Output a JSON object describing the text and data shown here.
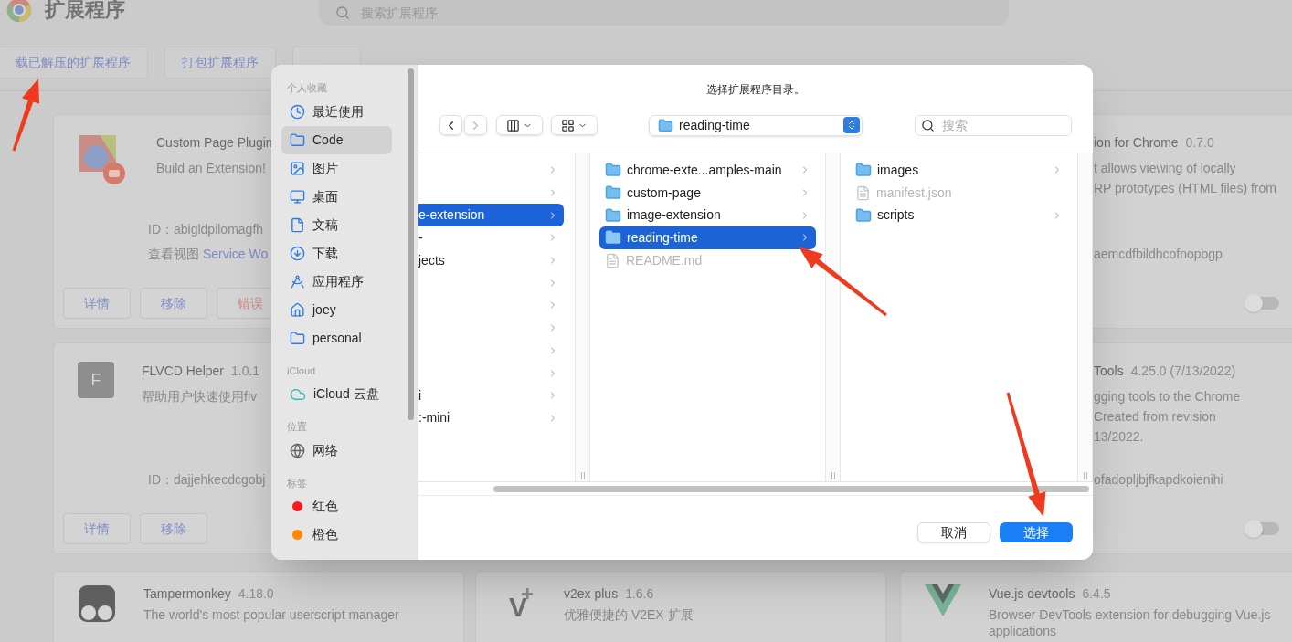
{
  "page": {
    "title": "扩展程序",
    "search": {
      "placeholder": "搜索扩展程序"
    },
    "actions": [
      "载已解压的扩展程序",
      "打包扩展程序"
    ]
  },
  "extensions": [
    {
      "kind": "custom-page",
      "name": "Custom Page Plugin",
      "description": [
        "Build an Extension!"
      ],
      "id_text": "ID：abigldpilomagfh",
      "views": {
        "label": "查看视图",
        "link": "Service Wo"
      },
      "buttons": [
        {
          "label": "详情",
          "kind": "normal"
        },
        {
          "label": "移除",
          "kind": "normal"
        },
        {
          "label": "错误",
          "kind": "error"
        }
      ]
    },
    {
      "name": "ion for Chrome",
      "version": "0.7.0",
      "description": [
        "t allows viewing of locally",
        "RP prototypes (HTML files) from"
      ],
      "id_text": "aemcdfbildhcofnopogp",
      "toggle": {
        "on": false
      }
    },
    {
      "kind": "letter",
      "icon_text": "F",
      "name": "FLVCD Helper",
      "version": "1.0.1",
      "description": [
        "帮助用户快速使用flv"
      ],
      "id_text": "ID：dajjehkecdcgobj",
      "buttons": [
        {
          "label": "详情",
          "kind": "normal"
        },
        {
          "label": "移除",
          "kind": "normal"
        }
      ]
    },
    {
      "name": "Tools",
      "version": "4.25.0 (7/13/2022)",
      "description": [
        "gging tools to the Chrome",
        "Created from revision",
        "13/2022."
      ],
      "id_text": "ofadopljbjfkapdkoienihi",
      "toggle": {
        "on": false
      }
    },
    {
      "kind": "tampermonkey",
      "name": "Tampermonkey",
      "version": "4.18.0",
      "description": [
        "The world's most popular userscript manager"
      ]
    },
    {
      "kind": "vplus",
      "icon_text": "V",
      "name": "v2ex plus",
      "version": "1.6.6",
      "description": [
        "优雅便捷的 V2EX 扩展"
      ]
    },
    {
      "kind": "vue",
      "name": "Vue.js devtools",
      "version": "6.4.5",
      "description": [
        "Browser DevTools extension for debugging Vue.js",
        "applications"
      ]
    }
  ],
  "dialog": {
    "title": "选择扩展程序目录。",
    "sidebar": [
      {
        "heading": "个人收藏",
        "items": [
          {
            "label": "最近使用",
            "kind": "clock",
            "selected": false
          },
          {
            "label": "Code",
            "kind": "folder",
            "selected": true
          },
          {
            "label": "图片",
            "kind": "image",
            "selected": false
          },
          {
            "label": "桌面",
            "kind": "desktop",
            "selected": false
          },
          {
            "label": "文稿",
            "kind": "document",
            "selected": false
          },
          {
            "label": "下载",
            "kind": "download",
            "selected": false
          },
          {
            "label": "应用程序",
            "kind": "apps",
            "selected": false
          },
          {
            "label": "joey",
            "kind": "home",
            "selected": false
          },
          {
            "label": "personal",
            "kind": "folder",
            "selected": false
          }
        ]
      },
      {
        "heading": "iCloud",
        "items": [
          {
            "label": "iCloud 云盘",
            "kind": "cloud",
            "selected": false
          }
        ]
      },
      {
        "heading": "位置",
        "items": [
          {
            "label": "网络",
            "kind": "globe",
            "selected": false
          }
        ]
      },
      {
        "heading": "标签",
        "items": [
          {
            "label": "红色",
            "kind": "tag",
            "color": "#ff1a1a",
            "selected": false
          },
          {
            "label": "橙色",
            "kind": "tag",
            "color": "#ff8a00",
            "selected": false
          }
        ]
      }
    ],
    "location": "reading-time",
    "search": {
      "placeholder": "搜索"
    },
    "columns": [
      {
        "items": [
          {
            "kind": "folder",
            "selected": false
          },
          {
            "kind": "folder",
            "selected": false
          },
          {
            "name": "e-extension",
            "kind": "folder",
            "selected": true
          },
          {
            "name": "-",
            "kind": "folder",
            "selected": false
          },
          {
            "name": "jects",
            "kind": "folder",
            "selected": false
          },
          {
            "kind": "folder",
            "selected": false
          },
          {
            "kind": "folder",
            "selected": false
          },
          {
            "kind": "folder",
            "selected": false
          },
          {
            "kind": "folder",
            "selected": false
          },
          {
            "kind": "folder",
            "selected": false
          },
          {
            "name": "i",
            "kind": "folder",
            "selected": false
          },
          {
            "name": ":-mini",
            "kind": "folder",
            "selected": false
          }
        ]
      },
      {
        "items": [
          {
            "name": "chrome-exte...amples-main",
            "kind": "folder",
            "selected": false
          },
          {
            "name": "custom-page",
            "kind": "folder",
            "selected": false
          },
          {
            "name": "image-extension",
            "kind": "folder",
            "selected": false
          },
          {
            "name": "reading-time",
            "kind": "folder",
            "selected": true
          },
          {
            "name": "README.md",
            "kind": "file",
            "selected": false
          }
        ]
      },
      {
        "items": [
          {
            "name": "images",
            "kind": "folder",
            "selected": false
          },
          {
            "name": "manifest.json",
            "kind": "file",
            "selected": false
          },
          {
            "name": "scripts",
            "kind": "folder",
            "selected": false
          }
        ]
      }
    ],
    "buttons": [
      {
        "label": "取消",
        "kind": "secondary"
      },
      {
        "label": "选择",
        "kind": "primary"
      }
    ]
  }
}
